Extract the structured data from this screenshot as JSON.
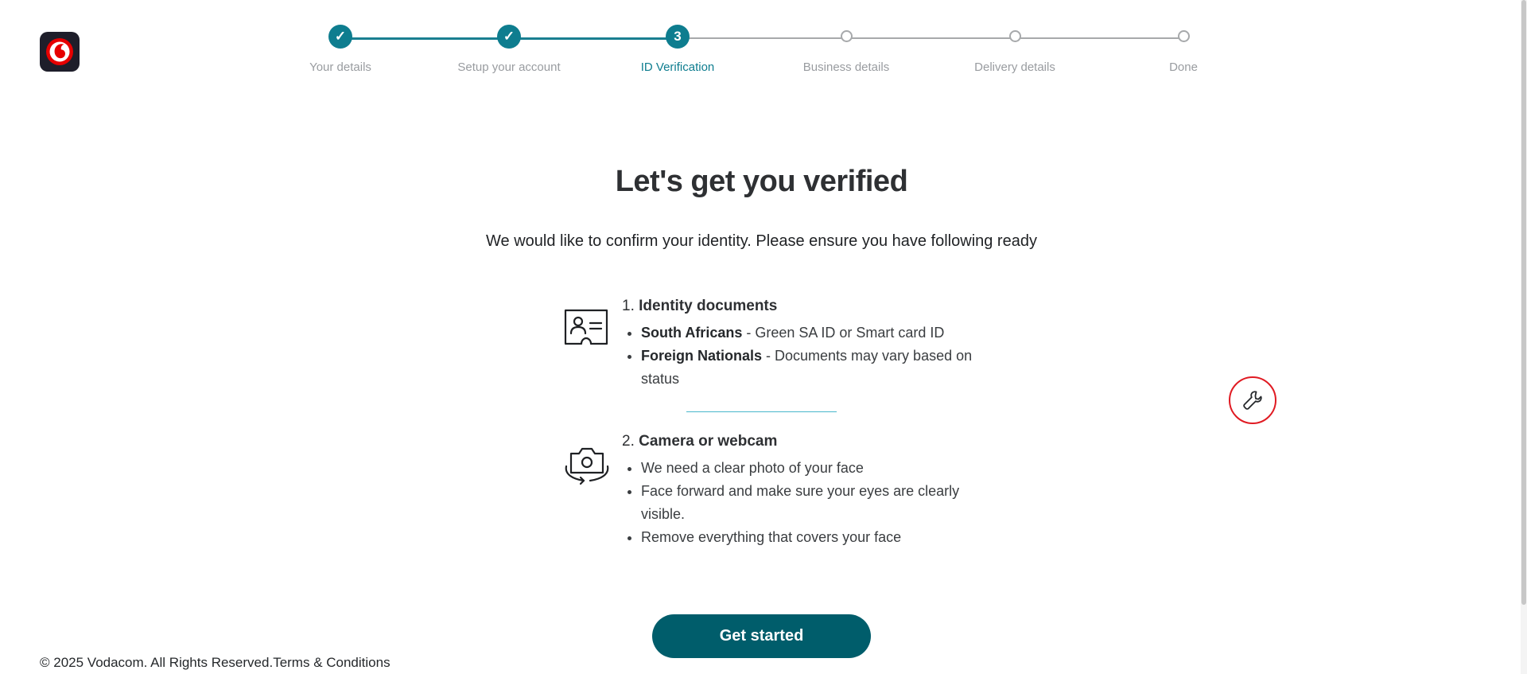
{
  "brand": {
    "logo_icon": "vodafone-logo-icon",
    "accent": "#e60000"
  },
  "stepper": {
    "steps": [
      {
        "label": "Your details",
        "state": "complete",
        "marker": "✓"
      },
      {
        "label": "Setup your account",
        "state": "complete",
        "marker": "✓"
      },
      {
        "label": "ID Verification",
        "state": "current",
        "marker": "3"
      },
      {
        "label": "Business details",
        "state": "pending",
        "marker": ""
      },
      {
        "label": "Delivery details",
        "state": "pending",
        "marker": ""
      },
      {
        "label": "Done",
        "state": "pending",
        "marker": ""
      }
    ],
    "colors": {
      "active": "#0e7d8f",
      "inactive": "#a7a9ab"
    }
  },
  "main": {
    "title": "Let's get you verified",
    "subtitle": "We would like to confirm your identity. Please ensure you have following ready",
    "requirements": [
      {
        "number": "1.",
        "title": "Identity documents",
        "icon": "id-card-icon",
        "items": [
          {
            "bold": "South Africans",
            "text": " - Green SA ID or Smart card ID"
          },
          {
            "bold": "Foreign Nationals",
            "text": " - Documents may vary based on status"
          }
        ]
      },
      {
        "number": "2.",
        "title": "Camera or webcam",
        "icon": "camera-icon",
        "items": [
          {
            "text": "We need a clear photo of your face"
          },
          {
            "text": "Face forward and make sure your eyes are clearly visible."
          },
          {
            "text": "Remove everything that covers your face"
          }
        ]
      }
    ],
    "cta_label": "Get started",
    "cta_color": "#005d6b"
  },
  "floating_tool": {
    "icon": "wrench-icon",
    "border_color": "#e01a22"
  },
  "footer": {
    "copyright": "© 2025 Vodacom. All Rights Reserved.",
    "terms_link": "Terms & Conditions"
  }
}
